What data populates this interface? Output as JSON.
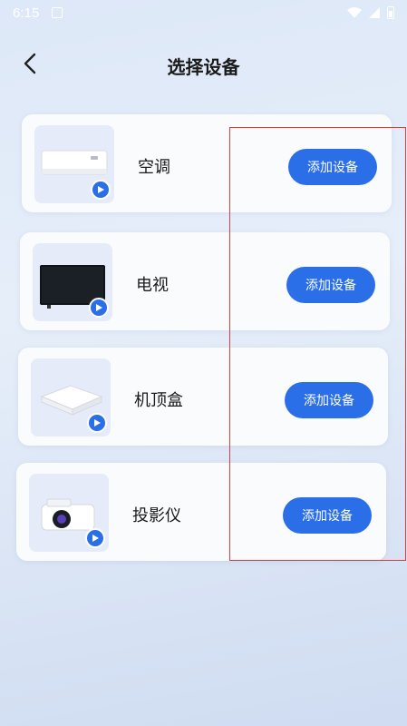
{
  "status_bar": {
    "time": "6:15"
  },
  "nav": {
    "title": "选择设备"
  },
  "devices": [
    {
      "name": "空调",
      "action": "添加设备"
    },
    {
      "name": "电视",
      "action": "添加设备"
    },
    {
      "name": "机顶盒",
      "action": "添加设备"
    },
    {
      "name": "投影仪",
      "action": "添加设备"
    }
  ],
  "colors": {
    "accent": "#2a6fe8",
    "highlight": "#e53838"
  },
  "icons": [
    "back-chevron-icon",
    "play-icon",
    "wifi-icon",
    "signal-icon",
    "battery-icon"
  ]
}
